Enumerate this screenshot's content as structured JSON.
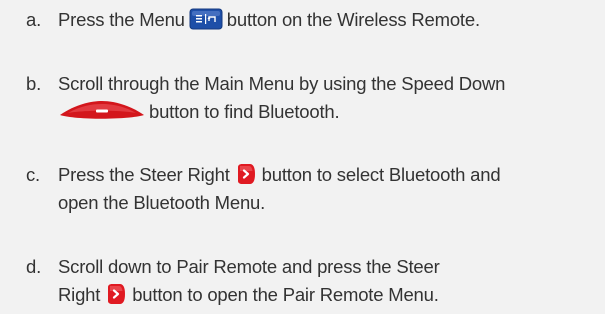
{
  "steps": [
    {
      "letter": "a.",
      "before": "Press the Menu",
      "icon": "menu-button-icon",
      "after": "button on the Wireless Remote."
    },
    {
      "letter": "b.",
      "line1": "Scroll through the Main Menu by using the Speed Down",
      "icon": "speed-down-button-icon",
      "after": "button to find Bluetooth."
    },
    {
      "letter": "c.",
      "before": "Press the Steer Right",
      "icon": "steer-right-button-icon",
      "after": "button to select Bluetooth and",
      "line2": "open the Bluetooth Menu."
    },
    {
      "letter": "d.",
      "line1": "Scroll down to Pair Remote and press the Steer",
      "before": "Right",
      "icon": "steer-right-button-icon",
      "after": "button to open the Pair Remote Menu."
    }
  ],
  "colors": {
    "background": "#f2f2f2",
    "text": "#333333",
    "menu_button": "#1e4fa8",
    "speed_button": "#d3161c",
    "steer_button": "#e01a22"
  }
}
